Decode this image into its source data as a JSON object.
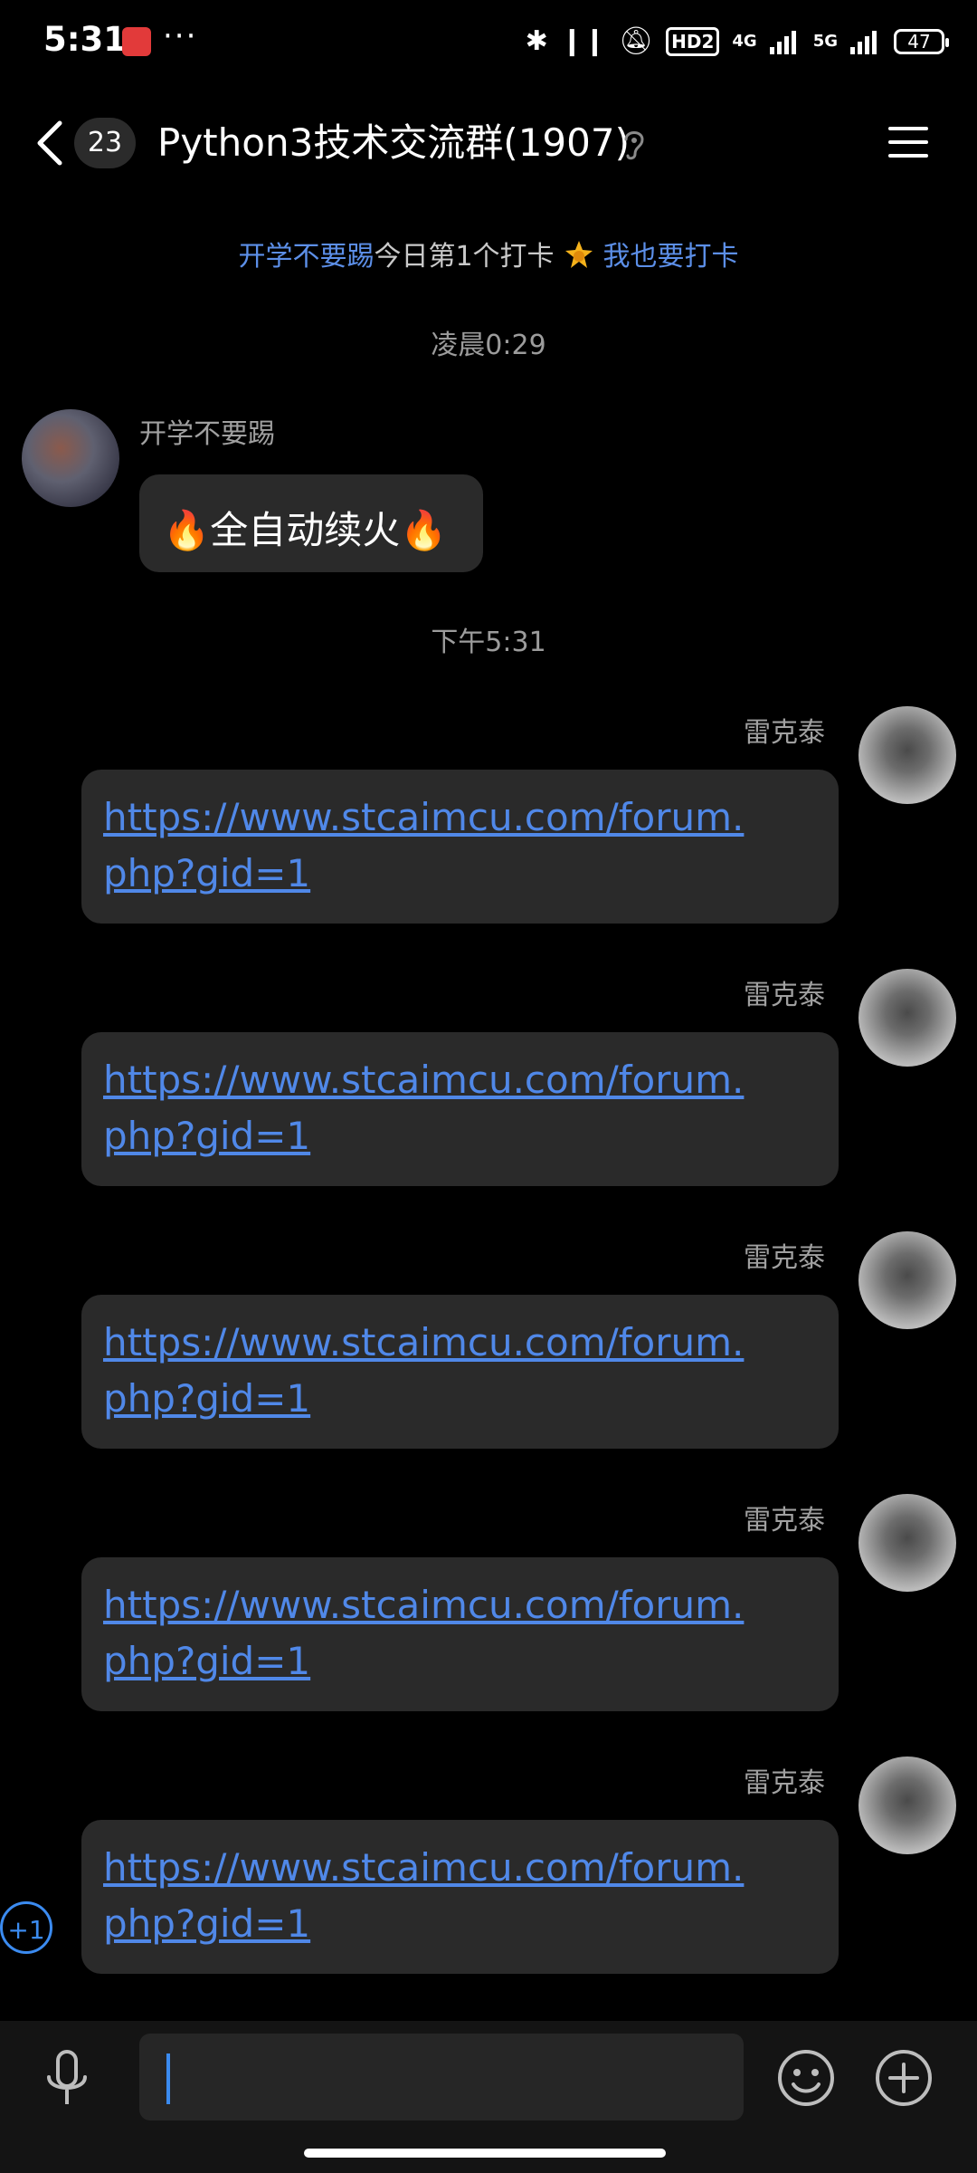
{
  "status_bar": {
    "time": "5:31",
    "more": "···",
    "hd": "HD2",
    "net1": "4G",
    "net2": "5G",
    "battery": "47"
  },
  "header": {
    "unread_count": "23",
    "title": "Python3技术交流群(1907)"
  },
  "checkin": {
    "user": "开学不要踢",
    "text": "今日第1个打卡",
    "action": "我也要打卡"
  },
  "timestamps": [
    "凌晨0:29",
    "下午5:31"
  ],
  "messages": [
    {
      "sender": "开学不要踢",
      "text": "🔥全自动续火🔥"
    },
    {
      "sender": "雷克泰",
      "text": "https://www.stcaimcu.com/forum.php?gid=1"
    },
    {
      "sender": "雷克泰",
      "text": "https://www.stcaimcu.com/forum.php?gid=1"
    },
    {
      "sender": "雷克泰",
      "text": "https://www.stcaimcu.com/forum.php?gid=1"
    },
    {
      "sender": "雷克泰",
      "text": "https://www.stcaimcu.com/forum.php?gid=1"
    },
    {
      "sender": "雷克泰",
      "text": "https://www.stcaimcu.com/forum.php?gid=1"
    }
  ],
  "plus_one": "+1",
  "colors": {
    "link": "#5088e8",
    "accent": "#3b8bf0",
    "bubble": "#2a2a2a"
  }
}
